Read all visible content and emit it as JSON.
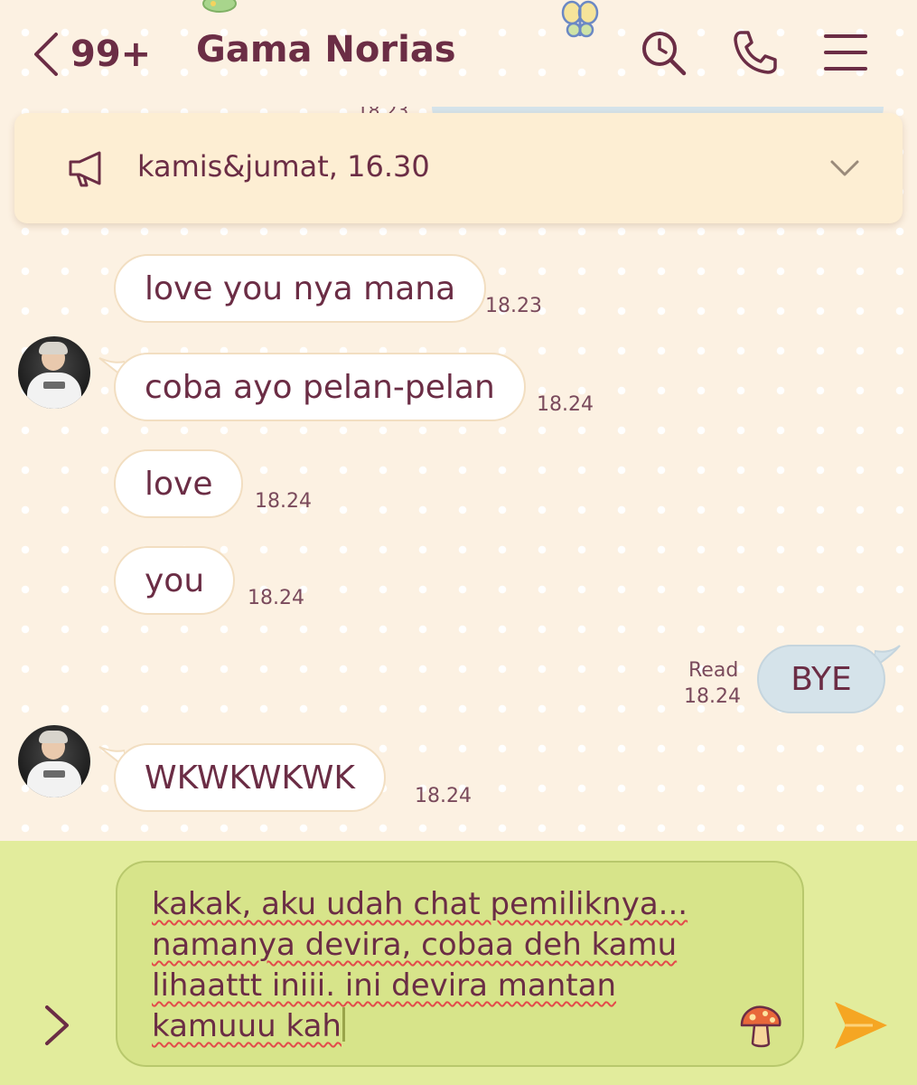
{
  "header": {
    "back_count": "99+",
    "title": "Gama Norias",
    "icons": [
      "chevron-left-icon",
      "search-icon",
      "phone-icon",
      "menu-icon"
    ]
  },
  "partial_top": {
    "time": "18.23"
  },
  "announcement": {
    "text": "kamis&jumat, 16.30",
    "icon": "megaphone-icon"
  },
  "messages": [
    {
      "side": "in",
      "text": "love you nya mana",
      "time": "18.23",
      "avatar": false
    },
    {
      "side": "in",
      "text": "coba ayo pelan-pelan",
      "time": "18.24",
      "avatar": true
    },
    {
      "side": "in",
      "text": "love",
      "time": "18.24",
      "avatar": false
    },
    {
      "side": "in",
      "text": "you",
      "time": "18.24",
      "avatar": false
    },
    {
      "side": "out",
      "text": "BYE",
      "status": "Read",
      "time": "18.24"
    },
    {
      "side": "in",
      "text": "WKWKWKWK",
      "time": "18.24",
      "avatar": true
    }
  ],
  "composer": {
    "text": "kakak, aku udah chat pemiliknya... namanya devira, cobaa deh kamu lihaattt iniii. ini devira mantan kamuuu kah",
    "icons": [
      "chevron-right-icon",
      "mushroom-sticker-icon",
      "send-icon"
    ]
  },
  "colors": {
    "background": "#fcf1e2",
    "text": "#6b2d45",
    "incoming_bubble": "#ffffff",
    "outgoing_bubble": "#d5e3ea",
    "announcement": "#fdeed3",
    "composer_bar": "#e2ec9c",
    "composer_input": "#d7e48a",
    "send": "#f5a623"
  }
}
